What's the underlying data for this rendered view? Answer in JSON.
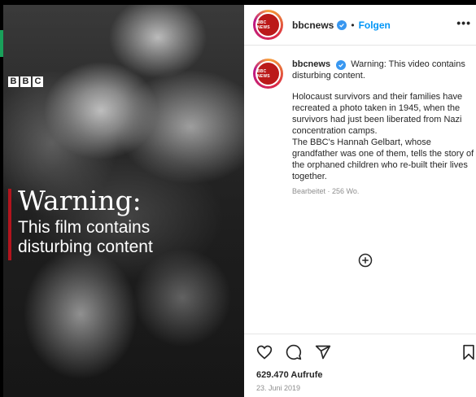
{
  "video": {
    "brand_logo_letters": [
      "B",
      "B",
      "C"
    ],
    "warning_title": "Warning:",
    "warning_line1": "This film contains",
    "warning_line2": "disturbing content",
    "accent_color": "#b3141d"
  },
  "header": {
    "avatar_text": "BBC NEWS",
    "username": "bbcnews",
    "separator": "•",
    "follow_label": "Folgen",
    "more_label": "•••"
  },
  "caption": {
    "avatar_text": "BBC NEWS",
    "username": "bbcnews",
    "first_line": "Warning: This video contains disturbing content.",
    "paragraph": "Holocaust survivors and their families have recreated a photo taken in 1945, when the survivors had just been liberated from Nazi concentration camps.\nThe BBC's Hannah Gelbart, whose grandfather was one of them, tells the story of the orphaned children who re-built their lives together.",
    "edited": "Bearbeitet · 256 Wo."
  },
  "actions": {
    "icons": [
      "heart-icon",
      "comment-icon",
      "share-icon",
      "bookmark-icon",
      "add-comment-icon"
    ]
  },
  "stats": {
    "views": "629.470 Aufrufe",
    "date": "23. Juni 2019"
  },
  "colors": {
    "follow": "#0095f6",
    "verified": "#3897f0",
    "bbc_red": "#bb1919"
  }
}
